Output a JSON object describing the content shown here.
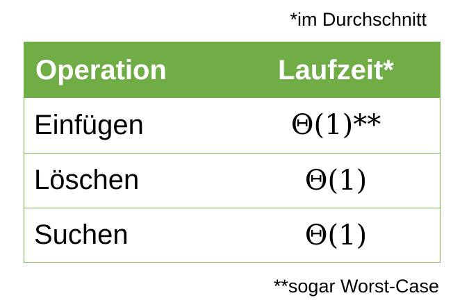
{
  "notes": {
    "top": "*im Durchschnitt",
    "bottom": "**sogar Worst-Case"
  },
  "table": {
    "headers": [
      "Operation",
      "Laufzeit*"
    ],
    "rows": [
      {
        "operation": "Einfügen",
        "runtime": "Θ(1)**"
      },
      {
        "operation": "Löschen",
        "runtime": "Θ(1)"
      },
      {
        "operation": "Suchen",
        "runtime": "Θ(1)"
      }
    ]
  },
  "colors": {
    "header_bg": "#70ad47",
    "header_text": "#ffffff",
    "border": "#70ad47"
  }
}
